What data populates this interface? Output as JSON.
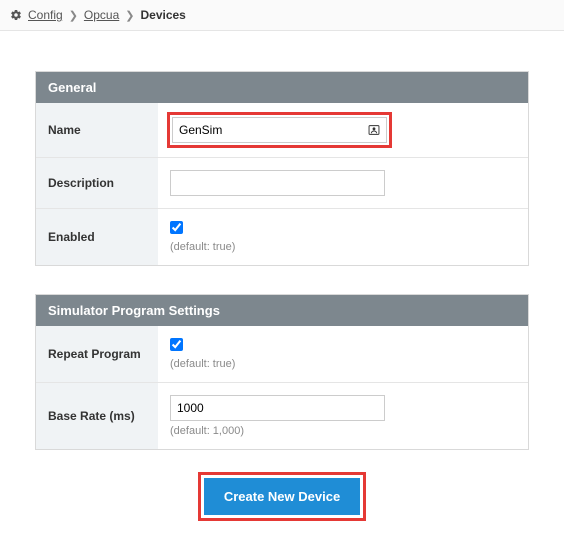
{
  "breadcrumb": {
    "items": [
      "Config",
      "Opcua",
      "Devices"
    ]
  },
  "general": {
    "title": "General",
    "name_label": "Name",
    "name_value": "GenSim",
    "description_label": "Description",
    "description_value": "",
    "enabled_label": "Enabled",
    "enabled_checked": true,
    "enabled_hint": "(default: true)"
  },
  "simulator": {
    "title": "Simulator Program Settings",
    "repeat_label": "Repeat Program",
    "repeat_checked": true,
    "repeat_hint": "(default: true)",
    "base_rate_label": "Base Rate (ms)",
    "base_rate_value": "1000",
    "base_rate_hint": "(default: 1,000)"
  },
  "actions": {
    "create_label": "Create New Device"
  }
}
